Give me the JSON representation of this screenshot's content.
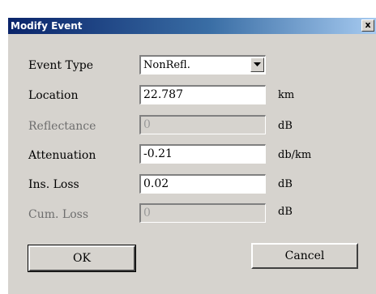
{
  "dialog": {
    "title": "Modify Event",
    "close_label": "x"
  },
  "fields": {
    "event_type": {
      "label": "Event Type",
      "value": "NonRefl."
    },
    "location": {
      "label": "Location",
      "value": "22.787",
      "unit": "km"
    },
    "reflectance": {
      "label": "Reflectance",
      "value": "0",
      "unit": "dB"
    },
    "attenuation": {
      "label": "Attenuation",
      "value": "-0.21",
      "unit": "db/km"
    },
    "ins_loss": {
      "label": "Ins. Loss",
      "value": "0.02",
      "unit": "dB"
    },
    "cum_loss": {
      "label": "Cum. Loss",
      "value": "0",
      "unit": "dB"
    }
  },
  "buttons": {
    "ok": "OK",
    "cancel": "Cancel"
  },
  "icons": {
    "close": "close-icon",
    "dropdown": "chevron-down-icon"
  }
}
